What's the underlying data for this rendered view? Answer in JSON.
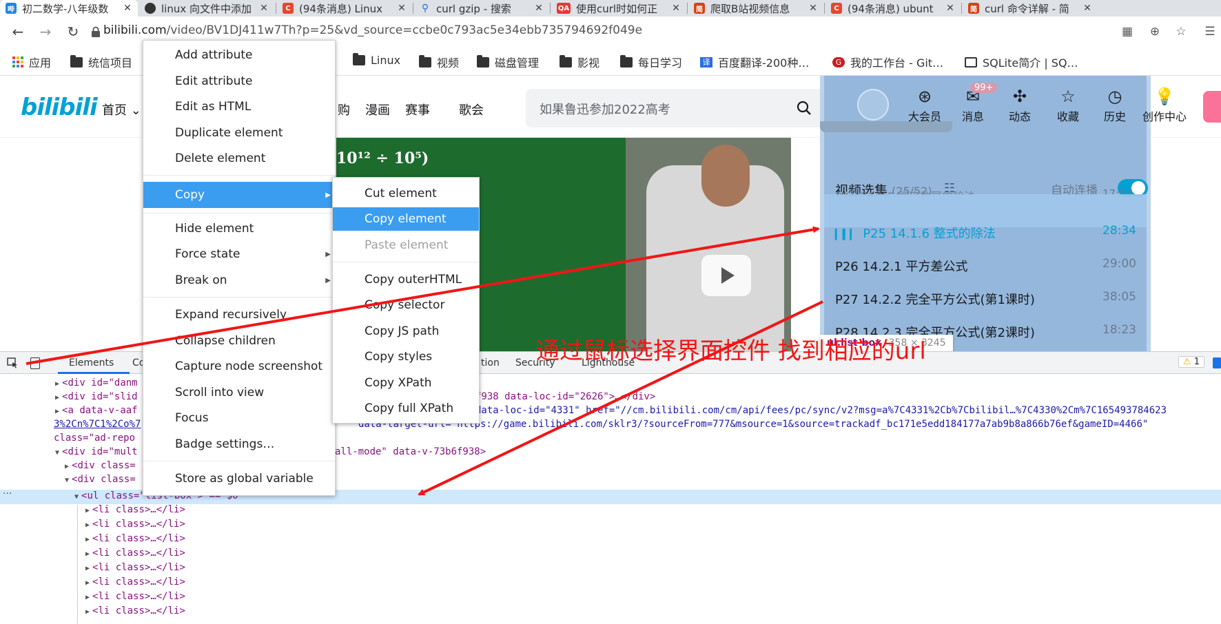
{
  "browser": {
    "tabs": [
      {
        "label": "初二数学-八年级数",
        "icon_color": "#1e88e5"
      },
      {
        "label": "linux 向文件中添加",
        "icon_color": "#333333"
      },
      {
        "label": "(94条消息) Linux",
        "icon_color": "#e5472e"
      },
      {
        "label": "curl gzip - 搜索",
        "icon_color": "#1a73e8"
      },
      {
        "label": "使用curl时如何正",
        "icon_color": "#e53935"
      },
      {
        "label": "爬取B站视频信息",
        "icon_color": "#d84315"
      },
      {
        "label": "(94条消息) ubunt",
        "icon_color": "#e5472e"
      },
      {
        "label": "curl 命令详解 - 简",
        "icon_color": "#d84315"
      }
    ],
    "tab_icon_glyphs": [
      "哔",
      "",
      "C",
      "Q",
      "QA",
      "简",
      "C",
      "简"
    ],
    "url_host": "bilibili.com",
    "url_path": "/video/BV1DJ411w7Th?p=25&vd_source=ccbe0c793ac5e34ebb735794692f049e",
    "bookmarks": [
      "应用",
      "统信项目",
      "Linux",
      "视频",
      "磁盘管理",
      "影视",
      "每日学习",
      "百度翻译-200种…",
      "我的工作台 - Git…",
      "SQLite简介 | SQ…"
    ]
  },
  "bilibili": {
    "logo": "bilibili",
    "nav": [
      "首页",
      "购",
      "漫画",
      "赛事",
      "歌会"
    ],
    "search_placeholder": "如果鲁迅参加2022高考",
    "header_icons": [
      {
        "label": "大会员",
        "icon": "vip-icon"
      },
      {
        "label": "消息",
        "icon": "message-icon",
        "badge": "99+"
      },
      {
        "label": "动态",
        "icon": "dynamic-icon"
      },
      {
        "label": "收藏",
        "icon": "favorite-icon"
      },
      {
        "label": "历史",
        "icon": "history-icon"
      },
      {
        "label": "创作中心",
        "icon": "creator-icon"
      }
    ],
    "formula": "10¹² ÷ 10⁵)",
    "playlist": {
      "title": "视频选集",
      "count": "(25/52)",
      "autoplay": "自动连播",
      "partial_top": "P24   14.1.5 同底数幂的除法",
      "partial_top_dur": "17:14",
      "episodes": [
        {
          "label": "P25   14.1.6 整式的除法",
          "duration": "28:34",
          "active": true
        },
        {
          "label": "P26   14.2.1 平方差公式",
          "duration": "29:00"
        },
        {
          "label": "P27   14.2.2 完全平方公式(第1课时)",
          "duration": "38:05"
        },
        {
          "label": "P28   14.2.3 完全平方公式(第2课时)",
          "duration": "18:23"
        }
      ]
    },
    "inspect_tooltip_tag": "ul.list-box",
    "inspect_tooltip_size": "358 × 3245"
  },
  "devtools": {
    "tabs": [
      "Elements",
      "Co",
      "tion",
      "Security",
      "Lighthouse"
    ],
    "warning_count": "1",
    "lines": [
      {
        "tag": "<div id=\"danm",
        "tail": "f938 data-loc-id=\"2626\">…</div>"
      },
      {
        "tag": "<div id=\"slid",
        "tail": ""
      },
      {
        "tag": "<a data-v-aaf",
        "tail": "data-loc-id=\"4331\" href=\"//cm.bilibili.com/cm/api/fees/pc/sync/v2?msg=a%7C4331%2Cb%7Cbilibil…%7C4330%2Cm%7C165493784623"
      },
      {
        "tag": "3%2Cn%7C1%2Co%7",
        "tail": "data-target-url=\"https://game.bilibili.com/sklr3/?sourceFrom=777&msource=1&source=trackadf_bc171e5edd184177a7ab9b8a866b76ef&gameID=4466\""
      },
      {
        "tag": "class=\"ad-repo",
        "tail": ""
      },
      {
        "tag": "<div id=\"mult",
        "tail": "all-mode\" data-v-73b6f938>"
      },
      {
        "tag": "<div class=",
        "tail": ""
      },
      {
        "tag": "<div class=",
        "tail": ""
      },
      {
        "tag": "<ul class=\"list-box\"> == $0",
        "tail": ""
      },
      {
        "tag": "<li class>…</li>",
        "tail": ""
      }
    ]
  },
  "context_menu": {
    "items": [
      "Add attribute",
      "Edit attribute",
      "Edit as HTML",
      "Duplicate element",
      "Delete element",
      "Copy",
      "Hide element",
      "Force state",
      "Break on",
      "Expand recursively",
      "Collapse children",
      "Capture node screenshot",
      "Scroll into view",
      "Focus",
      "Badge settings…",
      "Store as global variable"
    ],
    "submenu": [
      "Cut element",
      "Copy element",
      "Paste element",
      "Copy outerHTML",
      "Copy selector",
      "Copy JS path",
      "Copy styles",
      "Copy XPath",
      "Copy full XPath"
    ]
  },
  "annotation": "通过鼠标选择界面控件 找到相应的url",
  "colors": {
    "accent_blue": "#3a9df0",
    "annotation_red": "#f21515",
    "bilibili_blue": "#00a1d6",
    "bilibili_pink": "#fb7299",
    "selected_row": "#cfe8fc"
  }
}
